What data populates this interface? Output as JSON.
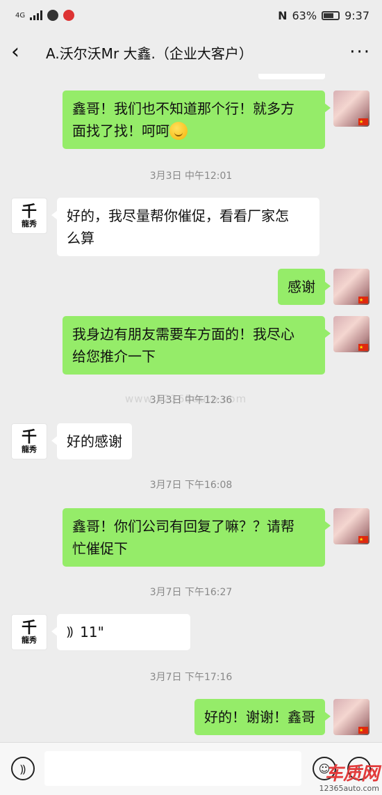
{
  "status_bar": {
    "network": "4G",
    "battery_percent": "63%",
    "time": "9:37"
  },
  "header": {
    "back_icon": "chevron-left-icon",
    "title": "A.沃尔沃Mr 大鑫.（企业大客户）",
    "more_icon": "more-dots-icon"
  },
  "messages": [
    {
      "sender": "me",
      "text": "鑫哥！我们也不知道那个行！就多方",
      "text2": "面找了找！呵呵",
      "emoji": "smile-emoji"
    },
    {
      "type": "time",
      "text": "3月3日 中午12:01"
    },
    {
      "sender": "other",
      "text": "好的，我尽量帮你催促，看看厂家怎",
      "text2": "么算"
    },
    {
      "sender": "me",
      "text": "感谢"
    },
    {
      "sender": "me",
      "text": "我身边有朋友需要车方面的！我尽心",
      "text2": "给您推介一下"
    },
    {
      "type": "time",
      "text": "3月3日 中午12:36"
    },
    {
      "sender": "other",
      "text": "好的感谢"
    },
    {
      "type": "time",
      "text": "3月7日 下午16:08"
    },
    {
      "sender": "me",
      "text": "鑫哥！你们公司有回复了嘛？？请帮",
      "text2": "忙催促下"
    },
    {
      "type": "time",
      "text": "3月7日 下午16:27"
    },
    {
      "sender": "other",
      "type": "voice",
      "duration": "11\""
    },
    {
      "type": "time",
      "text": "3月7日 下午17:16"
    },
    {
      "sender": "me",
      "text": "好的！谢谢！鑫哥"
    }
  ],
  "avatars": {
    "other_glyph_top": "千",
    "other_glyph_bottom": "龍秀"
  },
  "input_bar": {
    "voice_icon": "voice-input-icon",
    "emoji_icon": "emoji-icon",
    "plus_icon": "plus-icon",
    "placeholder": ""
  },
  "watermark": {
    "logo": "车质网",
    "url": "12365auto.com",
    "mid": "www.12365auto.com"
  }
}
